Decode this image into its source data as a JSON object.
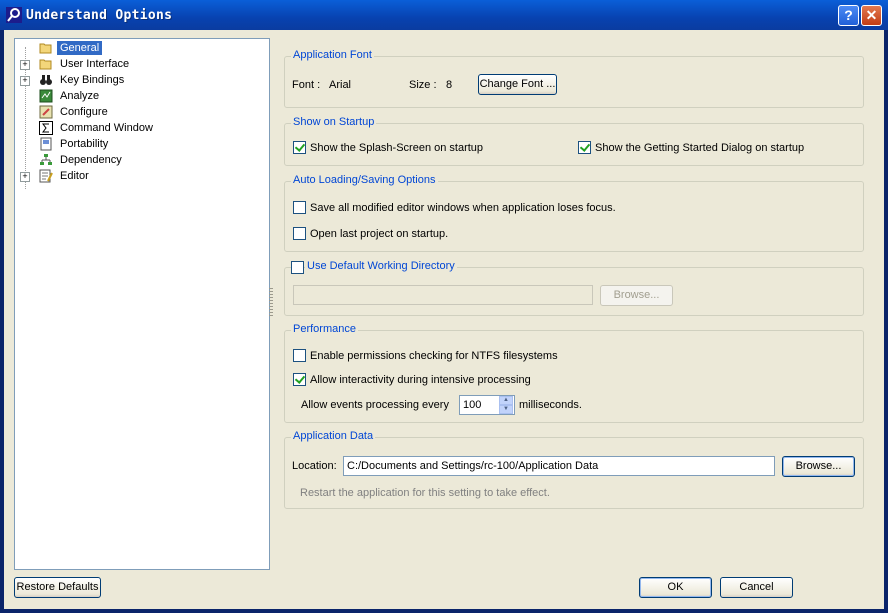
{
  "window": {
    "title": "Understand Options"
  },
  "titlebar": {
    "help_label": "?",
    "close_label": "✕"
  },
  "tree": {
    "items": [
      {
        "label": "General",
        "icon": "folder-open-icon",
        "expandable": false,
        "selected": true
      },
      {
        "label": "User Interface",
        "icon": "folder-icon",
        "expandable": true,
        "selected": false
      },
      {
        "label": "Key Bindings",
        "icon": "binoculars-icon",
        "expandable": true,
        "selected": false
      },
      {
        "label": "Analyze",
        "icon": "analyze-icon",
        "expandable": false,
        "selected": false
      },
      {
        "label": "Configure",
        "icon": "configure-icon",
        "expandable": false,
        "selected": false
      },
      {
        "label": "Command Window",
        "icon": "sigma-icon",
        "expandable": false,
        "selected": false
      },
      {
        "label": "Portability",
        "icon": "portability-icon",
        "expandable": false,
        "selected": false
      },
      {
        "label": "Dependency",
        "icon": "dependency-icon",
        "expandable": false,
        "selected": false
      },
      {
        "label": "Editor",
        "icon": "editor-icon",
        "expandable": true,
        "selected": false
      }
    ],
    "expand_glyph": "+"
  },
  "app_font": {
    "title": "Application Font",
    "font_label": "Font :",
    "font_value": "Arial",
    "size_label": "Size :",
    "size_value": "8",
    "change_button": "Change Font ..."
  },
  "startup": {
    "title": "Show on Startup",
    "splash_label": "Show the Splash-Screen on startup",
    "splash_checked": true,
    "getting_started_label": "Show the Getting Started Dialog on startup",
    "getting_started_checked": true
  },
  "autoload": {
    "title": "Auto Loading/Saving Options",
    "save_label": "Save all modified editor windows when application loses focus.",
    "save_checked": false,
    "open_last_label": "Open last project on startup.",
    "open_last_checked": false
  },
  "working_dir": {
    "title": "Use Default Working Directory",
    "checked": false,
    "path_value": "",
    "browse_button": "Browse..."
  },
  "performance": {
    "title": "Performance",
    "ntfs_label": "Enable permissions checking for NTFS filesystems",
    "ntfs_checked": false,
    "interactivity_label": "Allow interactivity during intensive processing",
    "interactivity_checked": true,
    "events_prefix": "Allow events processing every",
    "events_value": "100",
    "events_suffix": "milliseconds."
  },
  "app_data": {
    "title": "Application Data",
    "location_label": "Location:",
    "location_value": "C:/Documents and Settings/rc-100/Application Data",
    "browse_button": "Browse...",
    "note": "Restart the application for this setting to take effect."
  },
  "footer": {
    "restore_button": "Restore Defaults",
    "ok_button": "OK",
    "cancel_button": "Cancel"
  }
}
